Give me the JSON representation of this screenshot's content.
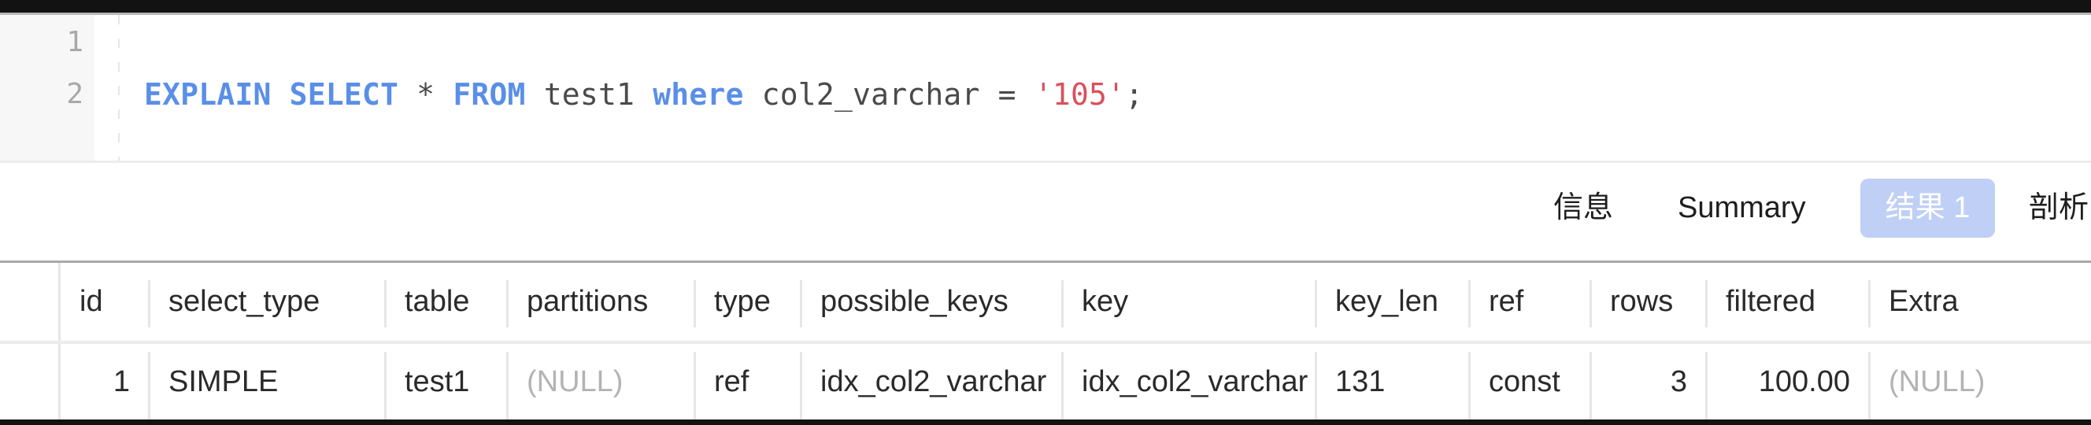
{
  "editor": {
    "line_numbers": [
      "1",
      "2"
    ],
    "line2_tokens": [
      {
        "text": "EXPLAIN",
        "type": "keyword"
      },
      {
        "text": " ",
        "type": "space"
      },
      {
        "text": "SELECT",
        "type": "keyword"
      },
      {
        "text": " * ",
        "type": "ident"
      },
      {
        "text": "FROM",
        "type": "keyword"
      },
      {
        "text": " test1 ",
        "type": "ident"
      },
      {
        "text": "where",
        "type": "keyword"
      },
      {
        "text": " col2_varchar = ",
        "type": "ident"
      },
      {
        "text": "'105'",
        "type": "string"
      },
      {
        "text": ";",
        "type": "ident"
      }
    ],
    "colors": {
      "keyword": "#5a8fe8",
      "string": "#d9505c",
      "ident": "#4a4a4a"
    }
  },
  "tabs": [
    {
      "label": "信息",
      "active": false
    },
    {
      "label": "Summary",
      "active": false
    },
    {
      "label": "结果 1",
      "active": true
    },
    {
      "label": "剖析",
      "active": false
    }
  ],
  "active_tab_color": "#bfcff5",
  "result_grid": {
    "columns": [
      "id",
      "select_type",
      "table",
      "partitions",
      "type",
      "possible_keys",
      "key",
      "key_len",
      "ref",
      "rows",
      "filtered",
      "Extra"
    ],
    "rows": [
      [
        "1",
        "SIMPLE",
        "test1",
        "(NULL)",
        "ref",
        "idx_col2_varchar",
        "idx_col2_varchar",
        "131",
        "const",
        "3",
        "100.00",
        "(NULL)"
      ]
    ]
  }
}
